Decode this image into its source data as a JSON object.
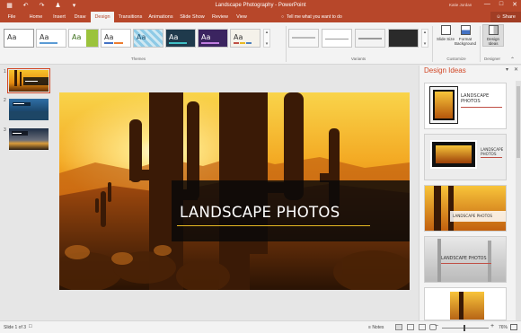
{
  "window": {
    "title": "Landscape Photography - PowerPoint",
    "user": "Katie Jordan",
    "qat_icons": [
      "save-icon",
      "undo-icon",
      "redo-icon",
      "presenter-icon",
      "customize-icon"
    ]
  },
  "tabs": [
    {
      "label": "File"
    },
    {
      "label": "Home"
    },
    {
      "label": "Insert"
    },
    {
      "label": "Draw"
    },
    {
      "label": "Design",
      "active": true
    },
    {
      "label": "Transitions"
    },
    {
      "label": "Animations"
    },
    {
      "label": "Slide Show"
    },
    {
      "label": "Review"
    },
    {
      "label": "View"
    }
  ],
  "tell_me": "Tell me what you want to do",
  "share": "Share",
  "ribbon": {
    "themes_label": "Themes",
    "variants_label": "Variants",
    "customize_label": "Customize",
    "designer_label": "Designer",
    "theme_sample": "Aa",
    "slide_size": "Slide Size",
    "format_background": "Format Background",
    "design_ideas": "Design Ideas"
  },
  "slides": [
    {
      "num": "1"
    },
    {
      "num": "2"
    },
    {
      "num": "3"
    }
  ],
  "main_slide": {
    "title": "LANDSCAPE PHOTOS"
  },
  "design_ideas": {
    "title": "Design Ideas",
    "idea_title_line1": "LANDSCAPE",
    "idea_title_line2": "PHOTOS",
    "idea_title": "LANDSCAPE PHOTOS"
  },
  "status": {
    "slide_info": "Slide 1 of 3",
    "notes": "Notes",
    "zoom": "76%"
  },
  "colors": {
    "accent": "#b7472a",
    "design_ideas_title": "#d24726",
    "title_underline": "#e8b923"
  }
}
